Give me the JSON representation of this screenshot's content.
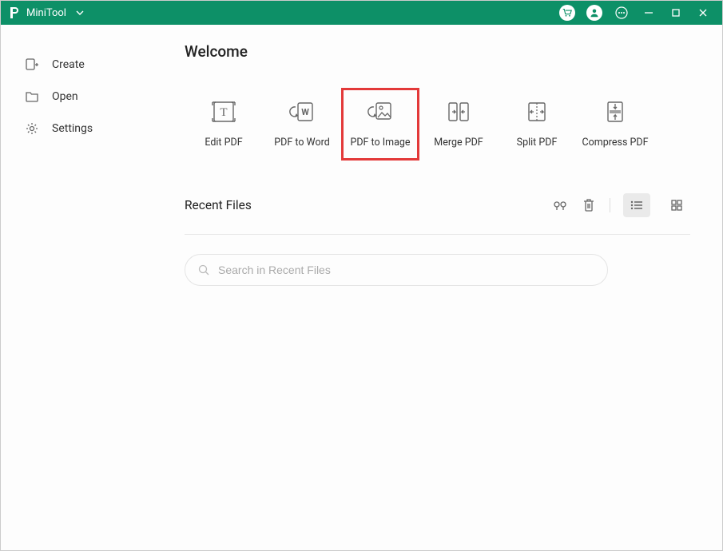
{
  "app": {
    "title": "MiniTool"
  },
  "sidebar": {
    "items": [
      {
        "label": "Create"
      },
      {
        "label": "Open"
      },
      {
        "label": "Settings"
      }
    ]
  },
  "main": {
    "welcome_title": "Welcome",
    "actions": [
      {
        "label": "Edit PDF"
      },
      {
        "label": "PDF to Word"
      },
      {
        "label": "PDF to Image"
      },
      {
        "label": "Merge PDF"
      },
      {
        "label": "Split PDF"
      },
      {
        "label": "Compress PDF"
      }
    ],
    "selected_action_index": 2,
    "recent": {
      "title": "Recent Files",
      "search_placeholder": "Search in Recent Files",
      "view_mode": "list"
    }
  },
  "colors": {
    "brand": "#0d9067",
    "highlight": "#e33939"
  }
}
